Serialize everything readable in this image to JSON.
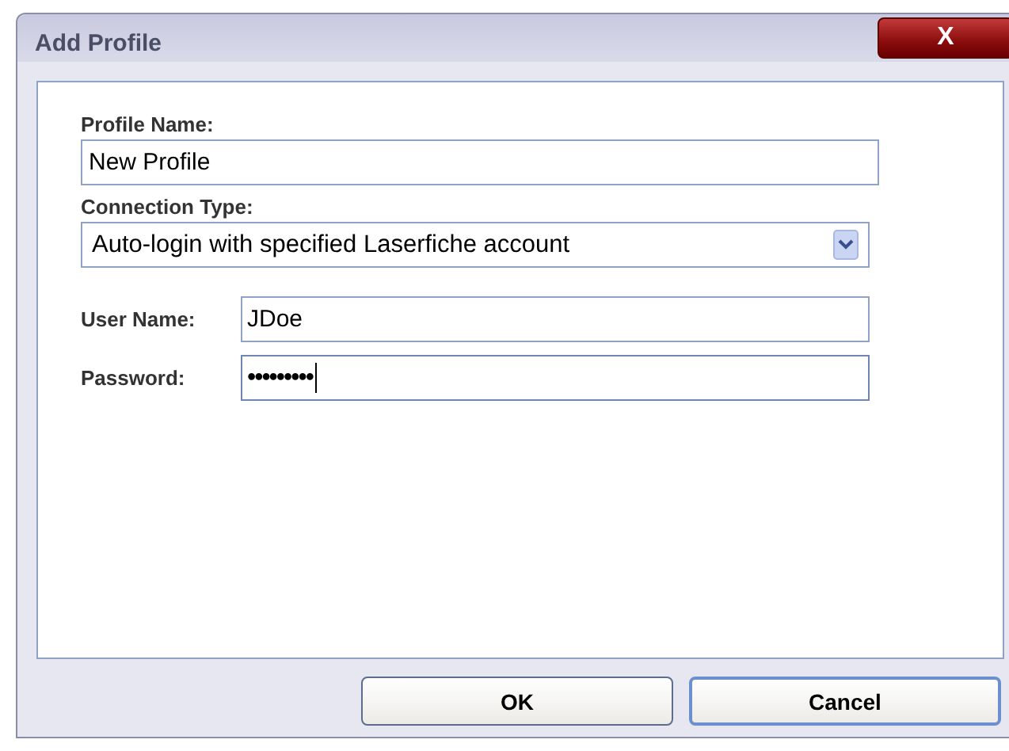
{
  "window": {
    "title": "Add Profile",
    "close": "X"
  },
  "fields": [
    {
      "kind": "text",
      "label": "Profile Name:",
      "value": "New Profile"
    },
    {
      "kind": "select",
      "label": "Connection Type:",
      "value": "Auto-login with specified Laserfiche account"
    }
  ],
  "credentials": [
    {
      "kind": "text",
      "label": "User Name:",
      "value": "JDoe",
      "focused": false
    },
    {
      "kind": "password",
      "label": "Password:",
      "value": "•••••••••",
      "focused": true
    }
  ],
  "buttons": [
    {
      "label": "OK",
      "default": false
    },
    {
      "label": "Cancel",
      "default": true
    }
  ]
}
